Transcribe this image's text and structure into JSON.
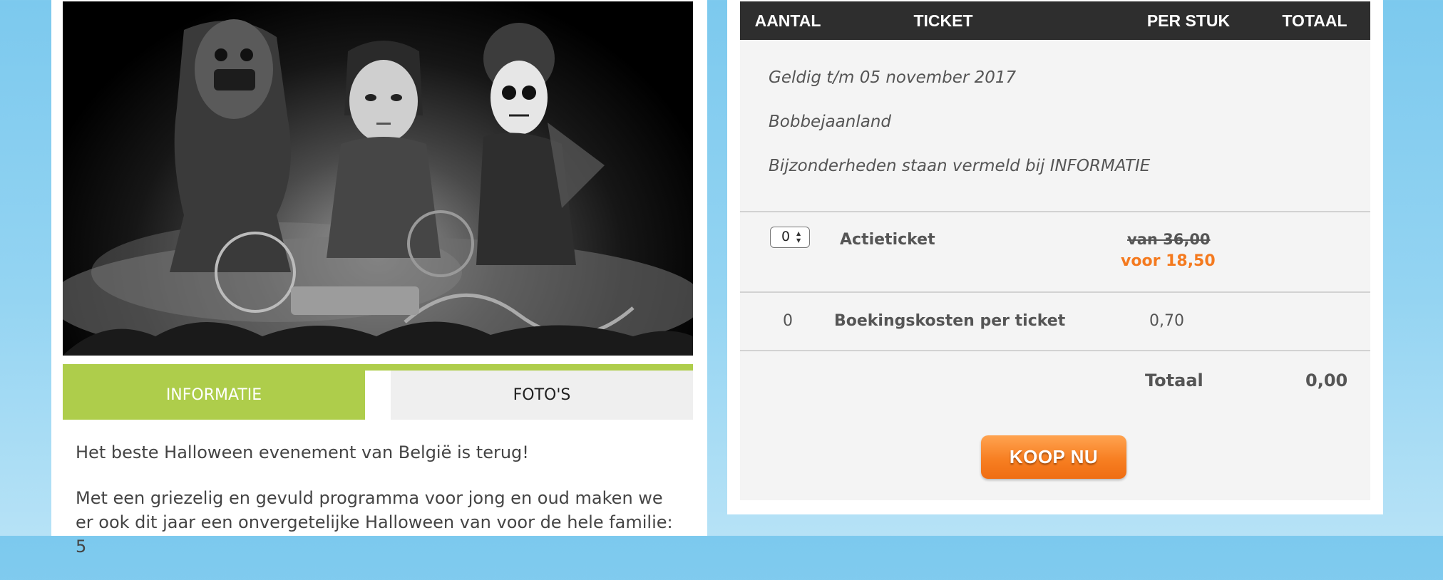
{
  "tabs": [
    {
      "label": "INFORMATIE",
      "active": true
    },
    {
      "label": "FOTO'S",
      "active": false
    }
  ],
  "description": [
    "Het beste Halloween evenement van België is terug!",
    "Met een griezelig en gevuld programma voor jong en oud maken we er ook dit jaar een onvergetelijke Halloween van voor de hele familie: 5"
  ],
  "table": {
    "headers": [
      "AANTAL",
      "TICKET",
      "PER STUK",
      "TOTAAL"
    ],
    "info": [
      "Geldig t/m 05 november 2017",
      "Bobbejaanland",
      "Bijzonderheden staan vermeld bij INFORMATIE"
    ],
    "rows": [
      {
        "quantity": "0",
        "ticket": "Actieticket",
        "old_price": "van 36,00",
        "price": "voor 18,50"
      },
      {
        "quantity": "0",
        "ticket": "Boekingskosten per ticket",
        "price": "0,70"
      }
    ],
    "total_label": "Totaal",
    "total_value": "0,00"
  },
  "buy_button": "KOOP NU",
  "colors": {
    "accent_green": "#aecd4b",
    "accent_orange": "#f47a1f",
    "header_dark": "#2e2e2e"
  }
}
